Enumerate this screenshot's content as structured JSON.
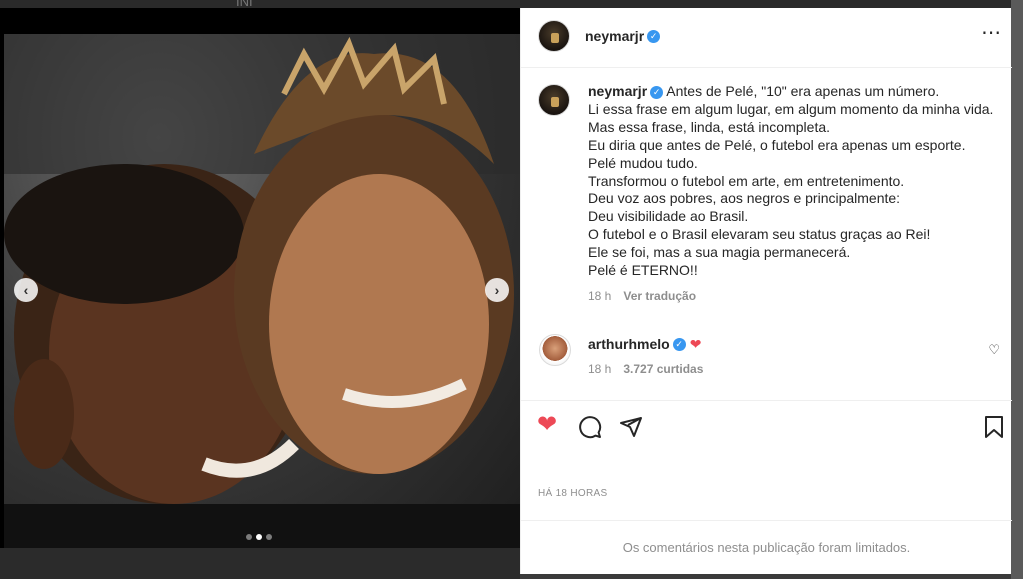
{
  "background": {
    "top_fragment": "INI"
  },
  "post": {
    "username": "neymarjr",
    "verified_badge": "✓",
    "more_icon": "⋯",
    "carousel": {
      "prev": "‹",
      "next": "›",
      "slide_count": 3,
      "active_slide": 2
    },
    "caption_lines": [
      "Antes de Pelé, \"10\" era apenas um número.",
      "Li essa frase em algum lugar, em algum momento da minha vida.",
      "Mas essa frase, linda, está incompleta.",
      "Eu diria que antes de Pelé, o futebol era apenas um esporte.",
      "Pelé mudou tudo.",
      "Transformou o futebol em arte, em entretenimento.",
      "Deu voz aos pobres, aos negros e principalmente:",
      "Deu visibilidade ao Brasil.",
      "O futebol e o Brasil elevaram seu status graças ao Rei!",
      "Ele se foi, mas a sua magia permanecerá.",
      "Pelé é ETERNO!!"
    ],
    "caption_time": "18 h",
    "see_translation": "Ver tradução",
    "comment": {
      "username": "arthurhmelo",
      "verified_badge": "✓",
      "heart": "❤",
      "time": "18 h",
      "likes": "3.727 curtidas",
      "like_icon": "♡"
    },
    "actions": {
      "like": "❤",
      "comment": "◯",
      "share": "➤",
      "save": "⎕"
    },
    "time_ago": "HÁ 18 HORAS",
    "comments_limited": "Os comentários nesta publicação foram limitados."
  },
  "colors": {
    "like_red": "#ed4956",
    "verified_blue": "#3897f0",
    "muted": "#8e8e8e"
  }
}
